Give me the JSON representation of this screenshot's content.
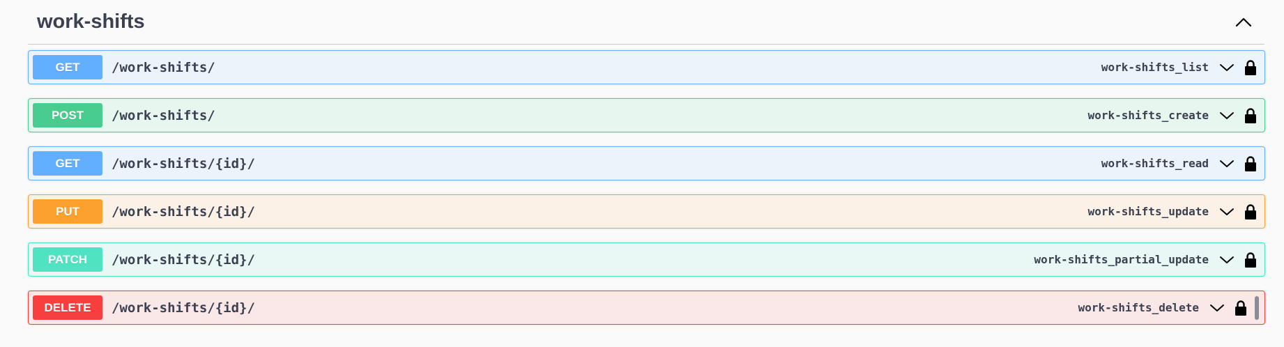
{
  "tag": {
    "title": "work-shifts"
  },
  "operations": [
    {
      "method": "GET",
      "path": "/work-shifts/",
      "operation_id": "work-shifts_list",
      "color": "#61affe"
    },
    {
      "method": "POST",
      "path": "/work-shifts/",
      "operation_id": "work-shifts_create",
      "color": "#49cc90"
    },
    {
      "method": "GET",
      "path": "/work-shifts/{id}/",
      "operation_id": "work-shifts_read",
      "color": "#61affe"
    },
    {
      "method": "PUT",
      "path": "/work-shifts/{id}/",
      "operation_id": "work-shifts_update",
      "color": "#fca130"
    },
    {
      "method": "PATCH",
      "path": "/work-shifts/{id}/",
      "operation_id": "work-shifts_partial_update",
      "color": "#50e3c2"
    },
    {
      "method": "DELETE",
      "path": "/work-shifts/{id}/",
      "operation_id": "work-shifts_delete",
      "color": "#f93e3e"
    }
  ],
  "icons": {
    "collapse": "chevron-up-icon",
    "expand": "chevron-down-icon",
    "auth": "lock-icon"
  }
}
